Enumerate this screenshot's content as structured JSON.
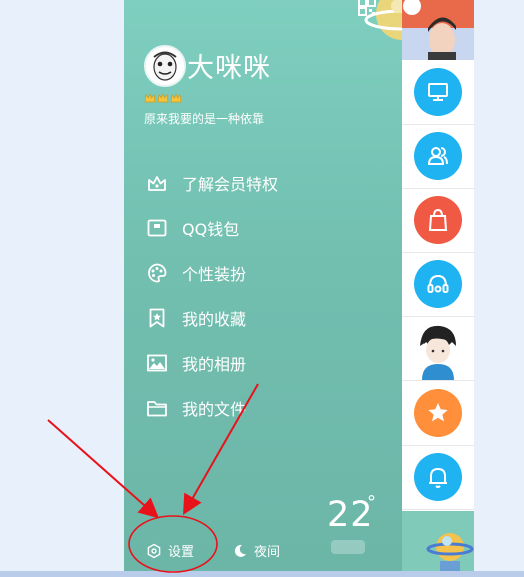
{
  "profile": {
    "nickname": "大咪咪",
    "signature": "原来我要的是一种依靠",
    "level_crowns": 3
  },
  "menu": [
    {
      "label": "了解会员特权",
      "icon": "vip-crown-icon"
    },
    {
      "label": "QQ钱包",
      "icon": "wallet-icon"
    },
    {
      "label": "个性装扮",
      "icon": "palette-icon"
    },
    {
      "label": "我的收藏",
      "icon": "bookmark-icon"
    },
    {
      "label": "我的相册",
      "icon": "photo-icon"
    },
    {
      "label": "我的文件",
      "icon": "folder-icon"
    }
  ],
  "weather": {
    "temperature": "22",
    "degree_symbol": "°"
  },
  "footer": {
    "settings_label": "设置",
    "night_label": "夜间"
  },
  "right_column_icons": [
    "contact-avatar-top",
    "monitor-icon",
    "contacts-icon",
    "shopping-bag-icon",
    "headset-icon",
    "contact-avatar-boy",
    "star-icon",
    "bell-icon",
    "planet-deco-icon"
  ],
  "colors": {
    "drawer_top": "#7fcfc0",
    "drawer_bottom": "#6cb6a8",
    "icon_blue": "#1fb3f2",
    "icon_red": "#f05a45",
    "icon_orange": "#ff8f3a",
    "annotation_red": "#e8121b"
  }
}
